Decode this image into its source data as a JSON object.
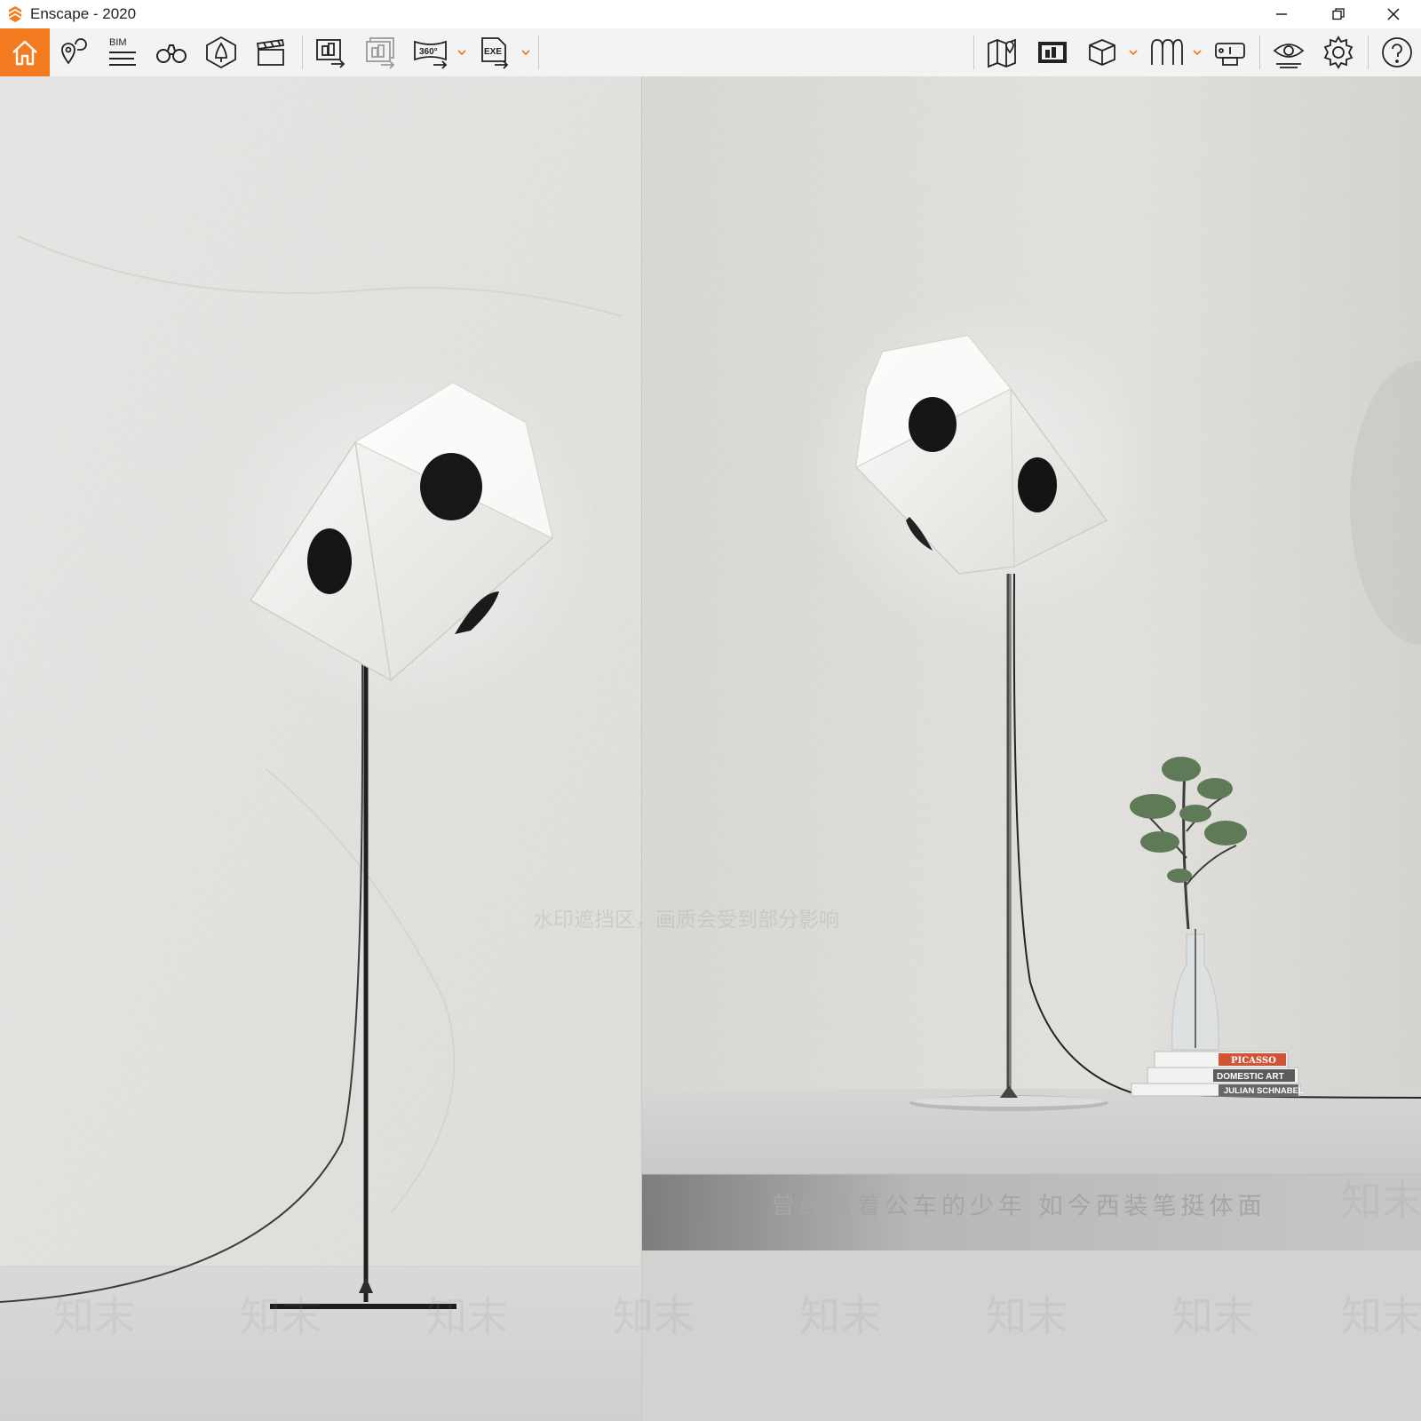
{
  "window": {
    "title": "Enscape - 2020",
    "accent_color": "#f47b20"
  },
  "toolbar": {
    "left_tools": [
      {
        "icon": "home-icon"
      },
      {
        "icon": "view-location-icon"
      },
      {
        "icon": "bim-icon",
        "label": "BIM"
      },
      {
        "icon": "binoculars-icon"
      },
      {
        "icon": "asset-library-icon"
      },
      {
        "icon": "video-editor-icon"
      },
      {
        "icon": "render-image-icon"
      },
      {
        "icon": "batch-render-icon"
      },
      {
        "icon": "panorama-360-icon",
        "label": "360°"
      },
      {
        "icon": "export-exe-icon",
        "label": "EXE"
      }
    ],
    "right_tools": [
      {
        "icon": "map-pin-icon"
      },
      {
        "icon": "capture-icon"
      },
      {
        "icon": "cube-view-icon"
      },
      {
        "icon": "vr-headset-icon"
      },
      {
        "icon": "info-icon"
      },
      {
        "icon": "visual-settings-icon"
      },
      {
        "icon": "settings-gear-icon"
      },
      {
        "icon": "help-icon"
      }
    ]
  },
  "viewport": {
    "caption": "曾经追着公车的少年 如今西装笔挺体面",
    "watermark_text": "知末",
    "watermark_notice": "水印遮挡区，画质会受到部分影响",
    "books": [
      "PICASSO",
      "DOMESTIC ART",
      "JULIAN SCHNABEL"
    ]
  }
}
